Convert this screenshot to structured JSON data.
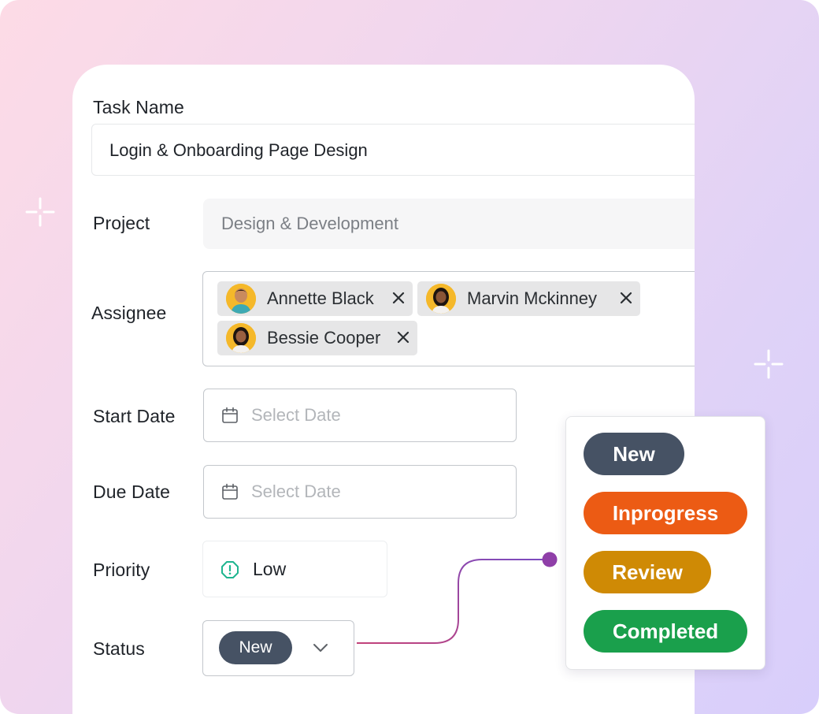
{
  "form": {
    "task_name_label": "Task Name",
    "task_name_value": "Login & Onboarding Page Design",
    "project_label": "Project",
    "project_value": "Design & Development",
    "assignee_label": "Assignee",
    "assignees": [
      {
        "name": "Annette Black"
      },
      {
        "name": "Marvin Mckinney"
      },
      {
        "name": "Bessie Cooper"
      }
    ],
    "start_date_label": "Start Date",
    "start_date_placeholder": "Select Date",
    "due_date_label": "Due Date",
    "due_date_placeholder": "Select Date",
    "priority_label": "Priority",
    "priority_value": "Low",
    "status_label": "Status",
    "status_value": "New"
  },
  "status_options": [
    {
      "label": "New",
      "color": "#465264"
    },
    {
      "label": "Inprogress",
      "color": "#ec5b14"
    },
    {
      "label": "Review",
      "color": "#cf8a05"
    },
    {
      "label": "Completed",
      "color": "#1aa04c"
    }
  ],
  "colors": {
    "priority_low": "#1fb58f",
    "connector_start": "#c2427a",
    "connector_end": "#7b4bc0"
  }
}
